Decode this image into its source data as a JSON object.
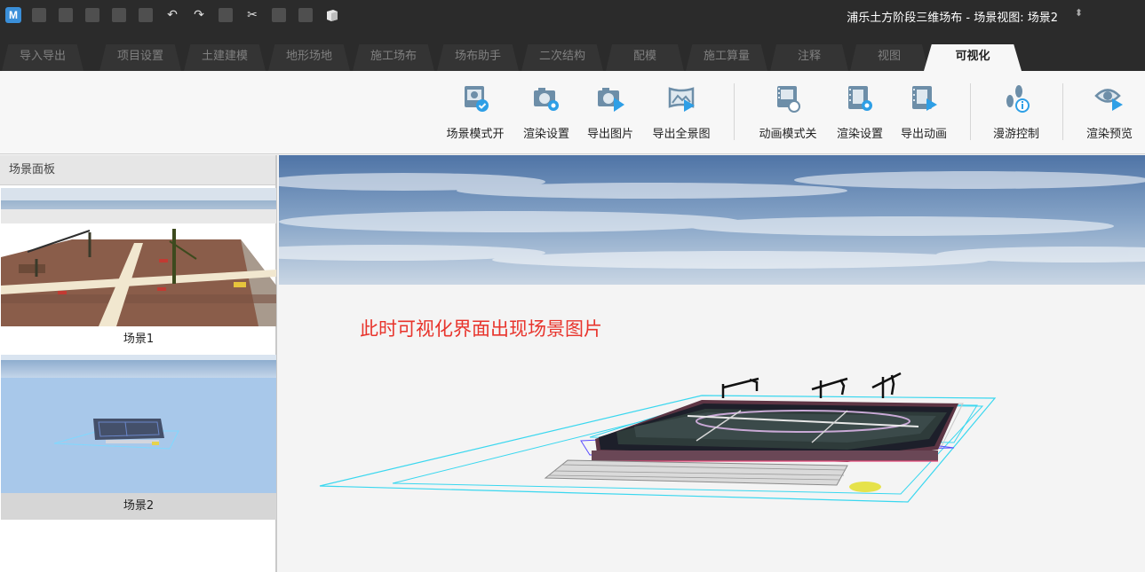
{
  "window": {
    "title": "浦乐土方阶段三维场布 - 场景视图: 场景2",
    "logo_letter": "M"
  },
  "quick_access": [
    {
      "icon": "new-file-icon"
    },
    {
      "icon": "open-file-icon"
    },
    {
      "icon": "save-icon"
    },
    {
      "icon": "save-as-icon"
    },
    {
      "icon": "copy-doc-icon"
    },
    {
      "icon": "undo-icon"
    },
    {
      "icon": "redo-icon"
    },
    {
      "icon": "select-icon"
    },
    {
      "icon": "cut-icon"
    },
    {
      "icon": "paste-icon"
    },
    {
      "icon": "print-icon"
    },
    {
      "icon": "cube-icon"
    }
  ],
  "tabs": [
    {
      "label": "导入导出"
    },
    {
      "label": "项目设置"
    },
    {
      "label": "土建建模"
    },
    {
      "label": "地形场地"
    },
    {
      "label": "施工场布"
    },
    {
      "label": "场布助手"
    },
    {
      "label": "二次结构"
    },
    {
      "label": "配模"
    },
    {
      "label": "施工算量"
    },
    {
      "label": "注释"
    },
    {
      "label": "视图"
    },
    {
      "label": "可视化",
      "active": true
    }
  ],
  "ribbon": {
    "buttons": [
      {
        "label": "场景模式开",
        "icon": "scene-mode-icon"
      },
      {
        "label": "渲染设置",
        "icon": "render-settings-icon"
      },
      {
        "label": "导出图片",
        "icon": "export-image-icon"
      },
      {
        "label": "导出全景图",
        "icon": "export-panorama-icon"
      },
      {
        "label": "动画模式关",
        "icon": "animation-mode-icon"
      },
      {
        "label": "渲染设置",
        "icon": "animation-render-settings-icon"
      },
      {
        "label": "导出动画",
        "icon": "export-animation-icon"
      },
      {
        "label": "漫游控制",
        "icon": "walkthrough-icon"
      },
      {
        "label": "渲染预览",
        "icon": "render-preview-icon"
      }
    ]
  },
  "scene_panel": {
    "title": "场景面板",
    "scenes": [
      {
        "label": "场景1"
      },
      {
        "label": "场景2",
        "selected": true
      }
    ]
  },
  "viewport": {
    "annotation": "此时可视化界面出现场景图片"
  },
  "colors": {
    "titlebar": "#2b2b2b",
    "accent_blue": "#3a8fd9",
    "annotation_red": "#e8342c"
  }
}
